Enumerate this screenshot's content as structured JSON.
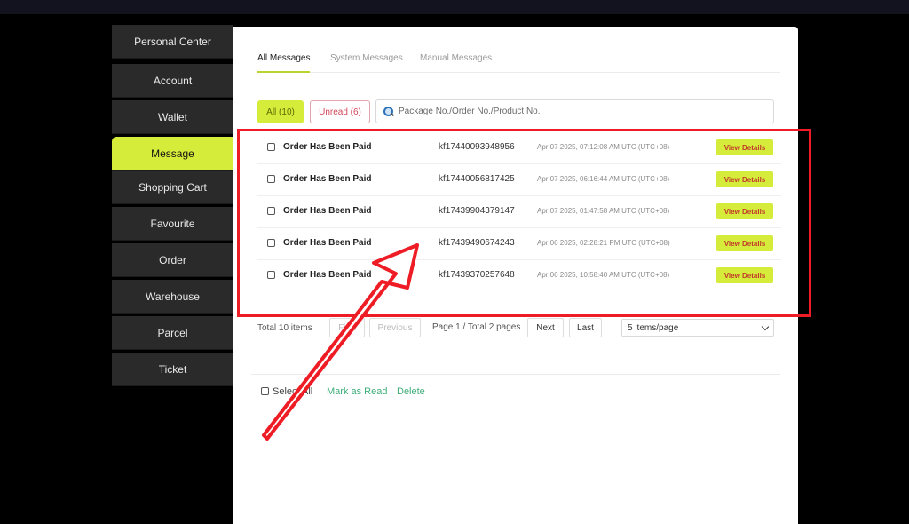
{
  "sidebar": {
    "items": [
      {
        "label": "Personal Center"
      },
      {
        "label": "Account"
      },
      {
        "label": "Wallet"
      },
      {
        "label": "Message"
      },
      {
        "label": "Shopping Cart"
      },
      {
        "label": "Favourite"
      },
      {
        "label": "Order"
      },
      {
        "label": "Warehouse"
      },
      {
        "label": "Parcel"
      },
      {
        "label": "Ticket"
      }
    ],
    "active": "Message"
  },
  "tabs": [
    {
      "label": "All Messages"
    },
    {
      "label": "System Messages"
    },
    {
      "label": "Manual Messages"
    }
  ],
  "filters": {
    "all": "All (10)",
    "unread": "Unread (6)"
  },
  "search": {
    "placeholder": "Package No./Order No./Product No."
  },
  "messages": [
    {
      "title": "Order Has Been Paid",
      "order_no": "kf17440093948956",
      "time": "Apr 07 2025, 07:12:08 AM UTC (UTC+08)",
      "action": "View Details"
    },
    {
      "title": "Order Has Been Paid",
      "order_no": "kf17440056817425",
      "time": "Apr 07 2025, 06:16:44 AM UTC (UTC+08)",
      "action": "View Details"
    },
    {
      "title": "Order Has Been Paid",
      "order_no": "kf17439904379147",
      "time": "Apr 07 2025, 01:47:58 AM UTC (UTC+08)",
      "action": "View Details"
    },
    {
      "title": "Order Has Been Paid",
      "order_no": "kf17439490674243",
      "time": "Apr 06 2025, 02:28:21 PM UTC (UTC+08)",
      "action": "View Details"
    },
    {
      "title": "Order Has Been Paid",
      "order_no": "kf17439370257648",
      "time": "Apr 06 2025, 10:58:40 AM UTC (UTC+08)",
      "action": "View Details"
    }
  ],
  "pagination": {
    "total": "Total 10 items",
    "first": "First",
    "previous": "Previous",
    "info": "Page 1 / Total 2 pages",
    "next": "Next",
    "last": "Last",
    "per_page": "5 items/page"
  },
  "footer": {
    "select_all": "Select All",
    "mark_read": "Mark as Read",
    "delete": "Delete"
  },
  "colors": {
    "accent": "#d6ec3b",
    "highlight": "#ee1c25",
    "link": "#3fae7a"
  }
}
